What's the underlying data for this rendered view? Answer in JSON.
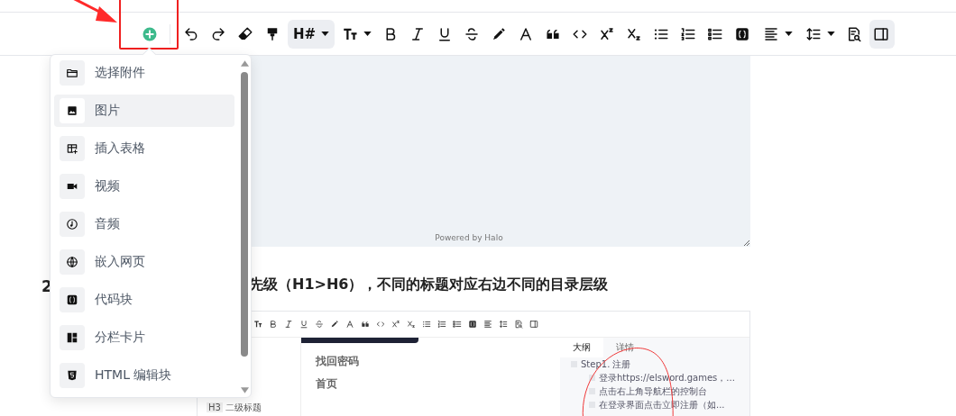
{
  "toolbar": {
    "insert_button": {
      "annotated": true
    },
    "items": [
      {
        "kind": "button",
        "active": false
      },
      {
        "kind": "button",
        "active": false
      },
      {
        "kind": "button",
        "active": false
      },
      {
        "kind": "button",
        "active": false
      },
      {
        "kind": "dropdown",
        "label": "H#",
        "active": true
      },
      {
        "kind": "dropdown",
        "active": false
      },
      {
        "kind": "button",
        "active": false
      },
      {
        "kind": "button",
        "active": false
      },
      {
        "kind": "button",
        "active": false
      },
      {
        "kind": "button",
        "active": false
      },
      {
        "kind": "button",
        "active": false
      },
      {
        "kind": "button",
        "active": false
      },
      {
        "kind": "button",
        "active": false
      },
      {
        "kind": "button",
        "active": false
      },
      {
        "kind": "button",
        "active": false
      },
      {
        "kind": "button",
        "active": false
      },
      {
        "kind": "button",
        "active": false
      },
      {
        "kind": "button",
        "active": false
      },
      {
        "kind": "button",
        "active": false
      },
      {
        "kind": "button",
        "active": false
      },
      {
        "kind": "dropdown",
        "active": false
      },
      {
        "kind": "dropdown",
        "active": false
      },
      {
        "kind": "button",
        "active": false
      },
      {
        "kind": "button",
        "active": true
      }
    ]
  },
  "insert_menu": {
    "items": [
      {
        "label": "选择附件",
        "selected": false
      },
      {
        "label": "图片",
        "selected": true
      },
      {
        "label": "插入表格",
        "selected": false
      },
      {
        "label": "视频",
        "selected": false
      },
      {
        "label": "音频",
        "selected": false
      },
      {
        "label": "嵌入网页",
        "selected": false
      },
      {
        "label": "代码块",
        "selected": false
      },
      {
        "label": "分栏卡片",
        "selected": false
      },
      {
        "label": "HTML 编辑块",
        "selected": false
      }
    ]
  },
  "side_number": "2",
  "embed": {
    "caption": "Powered by Halo"
  },
  "heading": "先级（H1>H6），不同的标题对应右边不同的目录层级",
  "screenshot": {
    "texts": [
      "找回密码",
      "首页"
    ],
    "side_item": {
      "badge": "H3",
      "label": "二级标题"
    },
    "outline": {
      "tabs": [
        {
          "label": "大纲",
          "selected": true
        },
        {
          "label": "详情",
          "selected": false
        }
      ],
      "items": [
        {
          "label": "Step1. 注册",
          "children": [
            {
              "label": "登录https://elsword.games，..."
            },
            {
              "label": "点击右上角导航栏的控制台"
            },
            {
              "label": "在登录界面点击立即注册（如..."
            }
          ]
        }
      ]
    }
  }
}
